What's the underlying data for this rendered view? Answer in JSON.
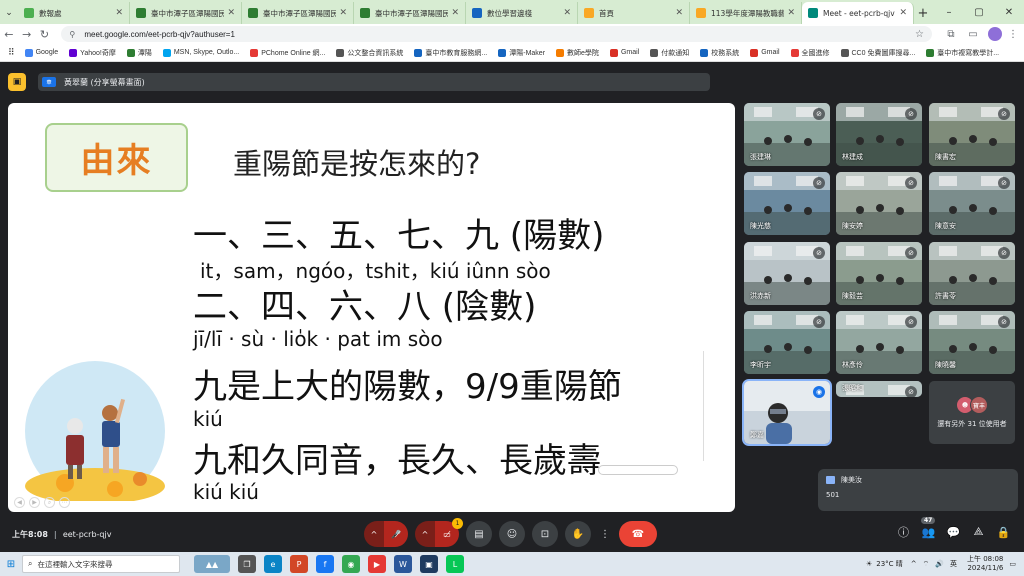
{
  "browser": {
    "tabs": [
      {
        "label": "數報處",
        "active": false,
        "color": "#4caf50"
      },
      {
        "label": "臺中市潭子區潭陽國民小",
        "active": false,
        "color": "#2e7d32"
      },
      {
        "label": "臺中市潭子區潭陽國民小",
        "active": false,
        "color": "#2e7d32"
      },
      {
        "label": "臺中市潭子區潭陽國民小",
        "active": false,
        "color": "#2e7d32"
      },
      {
        "label": "數位學習邊棧",
        "active": false,
        "color": "#1565c0"
      },
      {
        "label": "首頁",
        "active": false,
        "color": "#f9a825"
      },
      {
        "label": "113學年度潭陽教職藝",
        "active": false,
        "color": "#f9a825"
      },
      {
        "label": "Meet - eet-pcrb-qjv",
        "active": true,
        "color": "#00897b"
      }
    ],
    "url": "meet.google.com/eet-pcrb-qjv?authuser=1",
    "bookmarks": [
      {
        "label": "Google",
        "color": "#4285f4"
      },
      {
        "label": "Yahoo!奇摩",
        "color": "#6001d2"
      },
      {
        "label": "潭陽",
        "color": "#2e7d32"
      },
      {
        "label": "MSN, Skype, Outlo...",
        "color": "#00a4ef"
      },
      {
        "label": "PChome Online 網...",
        "color": "#e53935"
      },
      {
        "label": "公文整合資訊系統",
        "color": "#555555"
      },
      {
        "label": "臺中市教育服務網...",
        "color": "#1565c0"
      },
      {
        "label": "潭陽-Maker",
        "color": "#1565c0"
      },
      {
        "label": "數師e學院",
        "color": "#f57c00"
      },
      {
        "label": "Gmail",
        "color": "#d93025"
      },
      {
        "label": "付款通知",
        "color": "#555555"
      },
      {
        "label": "校務系統",
        "color": "#1565c0"
      },
      {
        "label": "Gmail",
        "color": "#d93025"
      },
      {
        "label": "全國進修",
        "color": "#e53935"
      },
      {
        "label": "CC0 免費圖庫搜尋...",
        "color": "#555555"
      },
      {
        "label": "臺中市複寫教學計...",
        "color": "#2e7d32"
      }
    ]
  },
  "meet": {
    "presenter_chip": "黃翠蘭 (分享螢幕畫面)",
    "time": "上午8:08",
    "code": "eet-pcrb-qjv",
    "participant_count": "47",
    "others_text": "還有另外 31 位使用者",
    "others_avatar_label": "寶丰",
    "chat": {
      "sender": "陳美汝",
      "message": "501"
    },
    "notification_badge": "1"
  },
  "slide": {
    "origin_label": "由來",
    "title": "重陽節是按怎來的?",
    "line1": "一、三、五、七、九 (陽數)",
    "line1_roman": "it，sam，ngóo，tshit，kiú iûnn sòo",
    "line2": "二、四、六、八    (陰數)",
    "line2_roman": "jī/lī · sù · lio̍k · pat    im sòo",
    "line3": "九是上大的陽數，9/9重陽節",
    "line3_roman": "kiú",
    "line4": "九和久同音，長久、長歲壽",
    "line4_roman": "kiú  kiú"
  },
  "participants": [
    {
      "name": "張建琳",
      "tone": "#8aa39b"
    },
    {
      "name": "林建成",
      "tone": "#4b5e55"
    },
    {
      "name": "陳書宏",
      "tone": "#7f8c7a"
    },
    {
      "name": "陳光慈",
      "tone": "#6b8aa0"
    },
    {
      "name": "陳安婷",
      "tone": "#9aa59a"
    },
    {
      "name": "陳意安",
      "tone": "#7b8d8c"
    },
    {
      "name": "洪赤新",
      "tone": "#b9c3c7"
    },
    {
      "name": "陳毅芸",
      "tone": "#8b9c8e"
    },
    {
      "name": "許書苓",
      "tone": "#8d9990"
    },
    {
      "name": "李昕宇",
      "tone": "#6e8c8a"
    },
    {
      "name": "林彥伶",
      "tone": "#93a7a0"
    },
    {
      "name": "陳曉馨",
      "tone": "#768b80"
    },
    {
      "name": "鄭嘉",
      "tone": "#8a93a0"
    },
    {
      "name": "張昭和",
      "tone": "#7e9490"
    }
  ],
  "taskbar": {
    "search_placeholder": "在這裡輸入文字來搜尋",
    "weather": "23°C 晴",
    "lang": "英",
    "clock_time": "上午 08:08",
    "clock_date": "2024/11/6"
  }
}
